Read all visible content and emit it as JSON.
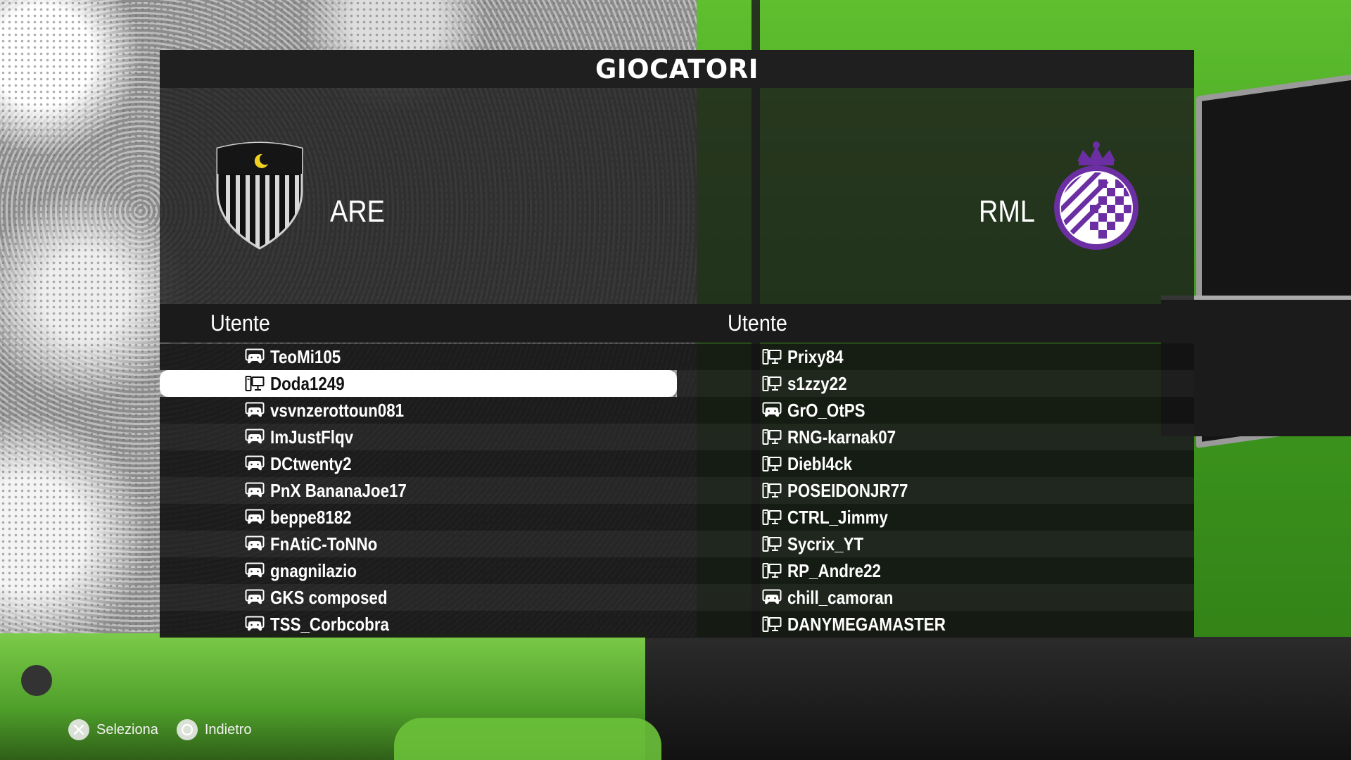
{
  "title": "GIOCATORI",
  "teams": {
    "left": {
      "abbr": "ARE",
      "crest_icon": "black-white-striped-shield-crest"
    },
    "right": {
      "abbr": "RML",
      "crest_icon": "purple-crowned-checkered-crest"
    }
  },
  "columns": {
    "left_header": "Utente",
    "right_header": "Utente"
  },
  "left_players": [
    {
      "name": "TeoMi105",
      "device": "controller-icon"
    },
    {
      "name": "Doda1249",
      "device": "pc-icon",
      "selected": true
    },
    {
      "name": "vsvnzerottoun081",
      "device": "controller-icon"
    },
    {
      "name": "ImJustFlqv",
      "device": "controller-icon"
    },
    {
      "name": "DCtwenty2",
      "device": "controller-icon"
    },
    {
      "name": "PnX BananaJoe17",
      "device": "controller-icon"
    },
    {
      "name": "beppe8182",
      "device": "controller-icon"
    },
    {
      "name": "FnAtiC-ToNNo",
      "device": "controller-icon"
    },
    {
      "name": "gnagnilazio",
      "device": "controller-icon"
    },
    {
      "name": "GKS composed",
      "device": "controller-icon"
    },
    {
      "name": "TSS_Corbcobra",
      "device": "controller-icon"
    }
  ],
  "right_players": [
    {
      "name": "Prixy84",
      "device": "pc-icon"
    },
    {
      "name": "s1zzy22",
      "device": "pc-icon"
    },
    {
      "name": "GrO_OtPS",
      "device": "controller-icon"
    },
    {
      "name": "RNG-karnak07",
      "device": "pc-icon"
    },
    {
      "name": "Diebl4ck",
      "device": "pc-icon"
    },
    {
      "name": "POSEIDONJR77",
      "device": "pc-icon"
    },
    {
      "name": "CTRL_Jimmy",
      "device": "pc-icon"
    },
    {
      "name": "Sycrix_YT",
      "device": "pc-icon"
    },
    {
      "name": "RP_Andre22",
      "device": "pc-icon"
    },
    {
      "name": "chill_camoran",
      "device": "controller-icon"
    },
    {
      "name": "DANYMEGAMASTER",
      "device": "pc-icon"
    }
  ],
  "footer": {
    "select_label": "Seleziona",
    "select_icon": "cross-button-icon",
    "back_label": "Indietro",
    "back_icon": "circle-button-icon"
  },
  "colors": {
    "selected_row": "#ffffff",
    "right_crest": "#6b2fa3",
    "left_crest": "#1a1a1a",
    "crescent": "#f0d020"
  }
}
